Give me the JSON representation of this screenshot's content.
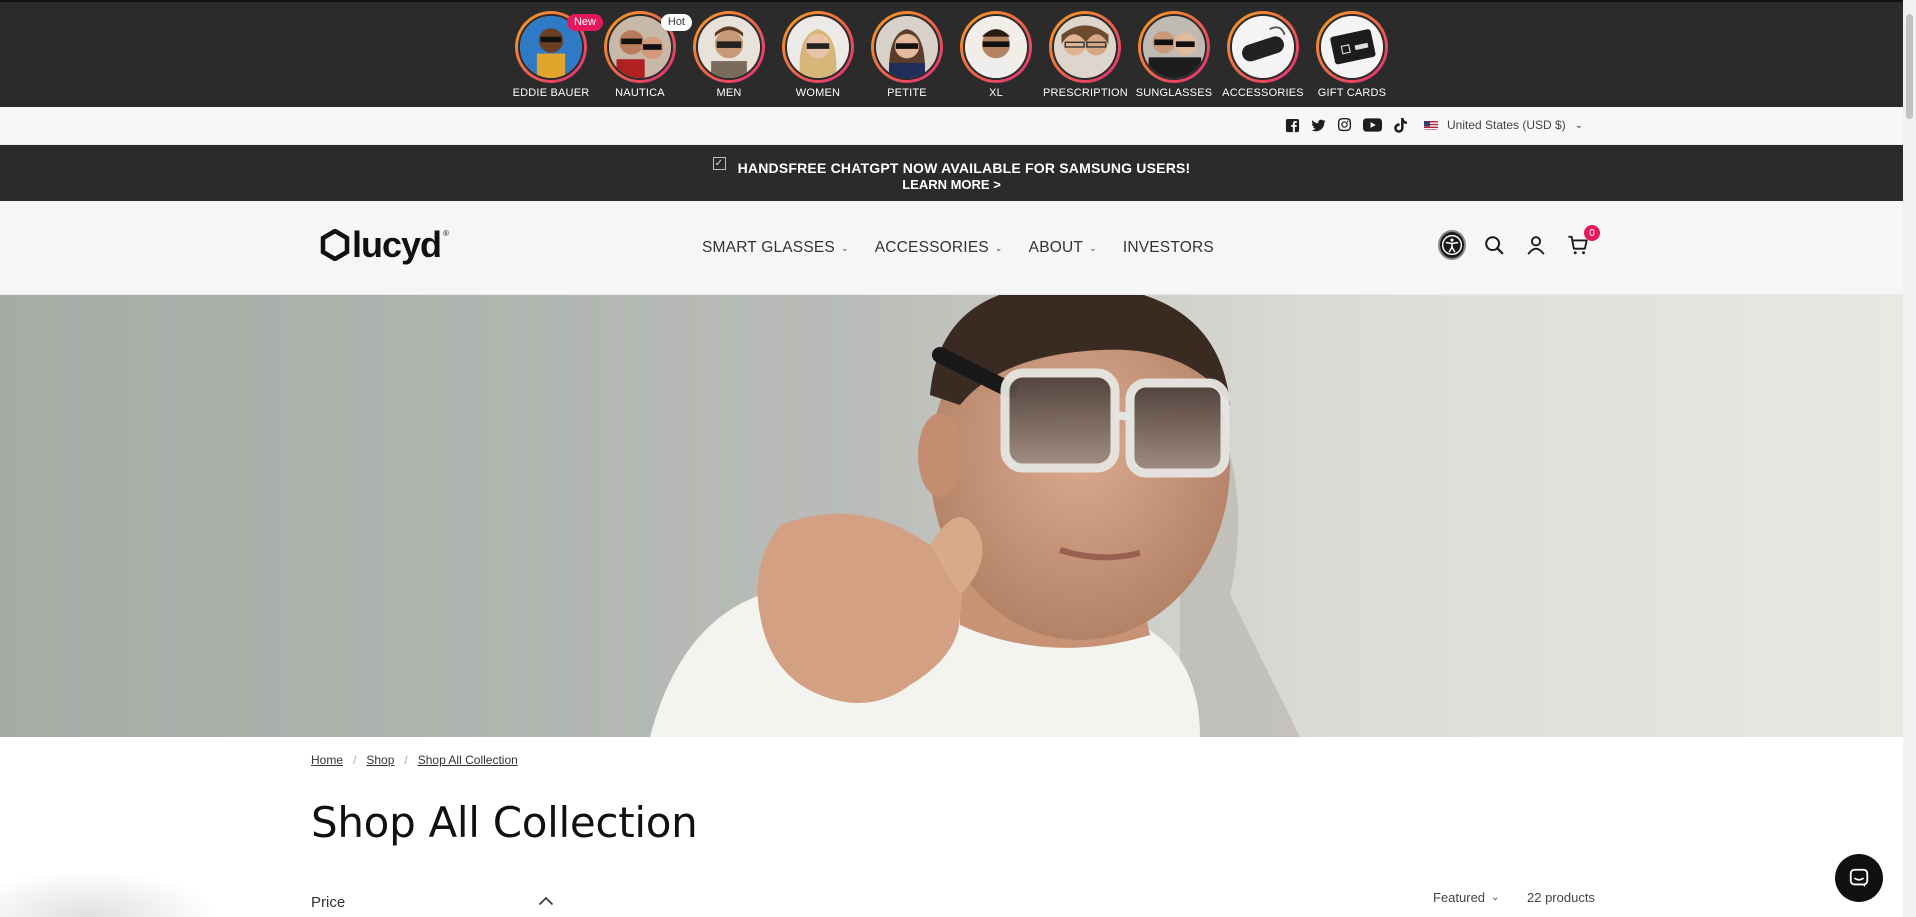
{
  "stories": [
    {
      "label": "EDDIE BAUER",
      "badge": "New"
    },
    {
      "label": "NAUTICA",
      "badge": "Hot"
    },
    {
      "label": "MEN",
      "badge": ""
    },
    {
      "label": "WOMEN",
      "badge": ""
    },
    {
      "label": "PETITE",
      "badge": ""
    },
    {
      "label": "XL",
      "badge": ""
    },
    {
      "label": "PRESCRIPTION",
      "badge": ""
    },
    {
      "label": "SUNGLASSES",
      "badge": ""
    },
    {
      "label": "ACCESSORIES",
      "badge": ""
    },
    {
      "label": "GIFT CARDS",
      "badge": ""
    }
  ],
  "utility": {
    "social_icons": [
      "facebook-icon",
      "twitter-icon",
      "instagram-icon",
      "youtube-icon",
      "tiktok-icon"
    ],
    "locale": "United States (USD $)"
  },
  "announcement": {
    "line1": "HANDSFREE CHATGPT NOW AVAILABLE FOR SAMSUNG USERS!",
    "line2": "LEARN MORE >"
  },
  "header": {
    "logo_text": "lucyd",
    "logo_mark": "®",
    "nav": [
      {
        "label": "SMART GLASSES",
        "has_dropdown": true
      },
      {
        "label": "ACCESSORIES",
        "has_dropdown": true
      },
      {
        "label": "ABOUT",
        "has_dropdown": true
      },
      {
        "label": "INVESTORS",
        "has_dropdown": false
      }
    ],
    "icons": [
      "accessibility-icon",
      "search-icon",
      "account-icon",
      "cart-icon"
    ],
    "cart_count": "0"
  },
  "breadcrumb": [
    "Home",
    "Shop",
    "Shop All Collection"
  ],
  "page_title": "Shop All Collection",
  "filters": {
    "price_label": "Price"
  },
  "toolbar": {
    "sort_label": "Featured",
    "product_count": "22 products"
  },
  "colors": {
    "dark_bar": "#2b2b2b",
    "accent": "#e4185c",
    "story_ring_start": "#f7a21b",
    "story_ring_end": "#e4297b"
  }
}
